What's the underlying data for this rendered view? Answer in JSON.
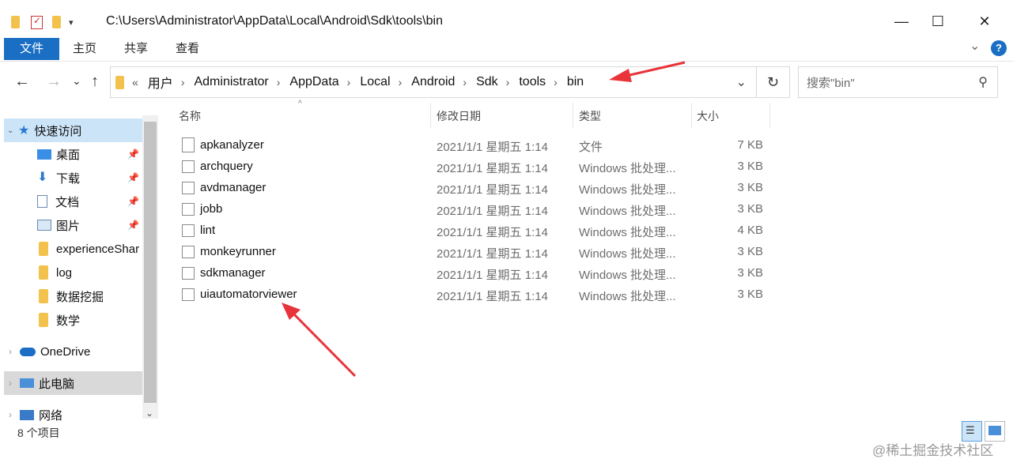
{
  "window": {
    "path_title": "C:\\Users\\Administrator\\AppData\\Local\\Android\\Sdk\\tools\\bin",
    "min_glyph": "—",
    "max_glyph": "☐",
    "close_glyph": "✕"
  },
  "ribbon": {
    "tabs": [
      "文件",
      "主页",
      "共享",
      "查看"
    ],
    "expand_glyph": "⌄",
    "help_glyph": "?"
  },
  "nav": {
    "back_glyph": "←",
    "forward_glyph": "→",
    "recent_glyph": "⌄",
    "up_glyph": "↑",
    "overflow": "«",
    "breadcrumbs": [
      "用户",
      "Administrator",
      "AppData",
      "Local",
      "Android",
      "Sdk",
      "tools",
      "bin"
    ],
    "dropdown_glyph": "⌄",
    "refresh_glyph": "↻",
    "search_placeholder": "搜索\"bin\"",
    "search_glyph": "⚲"
  },
  "sidebar": {
    "quick_access": "快速访问",
    "items": [
      {
        "label": "桌面",
        "pinned": true
      },
      {
        "label": "下载",
        "pinned": true
      },
      {
        "label": "文档",
        "pinned": true
      },
      {
        "label": "图片",
        "pinned": true
      },
      {
        "label": "experienceShar",
        "pinned": false
      },
      {
        "label": "log",
        "pinned": false
      },
      {
        "label": "数据挖掘",
        "pinned": false
      },
      {
        "label": "数学",
        "pinned": false
      }
    ],
    "onedrive": "OneDrive",
    "this_pc": "此电脑",
    "network": "网络"
  },
  "columns": {
    "name": "名称",
    "date": "修改日期",
    "type": "类型",
    "size": "大小"
  },
  "files": [
    {
      "name": "apkanalyzer",
      "date": "2021/1/1 星期五 1:14",
      "type": "文件",
      "size": "7 KB"
    },
    {
      "name": "archquery",
      "date": "2021/1/1 星期五 1:14",
      "type": "Windows 批处理...",
      "size": "3 KB"
    },
    {
      "name": "avdmanager",
      "date": "2021/1/1 星期五 1:14",
      "type": "Windows 批处理...",
      "size": "3 KB"
    },
    {
      "name": "jobb",
      "date": "2021/1/1 星期五 1:14",
      "type": "Windows 批处理...",
      "size": "3 KB"
    },
    {
      "name": "lint",
      "date": "2021/1/1 星期五 1:14",
      "type": "Windows 批处理...",
      "size": "4 KB"
    },
    {
      "name": "monkeyrunner",
      "date": "2021/1/1 星期五 1:14",
      "type": "Windows 批处理...",
      "size": "3 KB"
    },
    {
      "name": "sdkmanager",
      "date": "2021/1/1 星期五 1:14",
      "type": "Windows 批处理...",
      "size": "3 KB"
    },
    {
      "name": "uiautomatorviewer",
      "date": "2021/1/1 星期五 1:14",
      "type": "Windows 批处理...",
      "size": "3 KB"
    }
  ],
  "status": "8 个项目",
  "watermark": "@稀土掘金技术社区",
  "colors": {
    "accent": "#1a6fc4",
    "selection": "#cce4f7",
    "arrow": "#e8333a"
  }
}
